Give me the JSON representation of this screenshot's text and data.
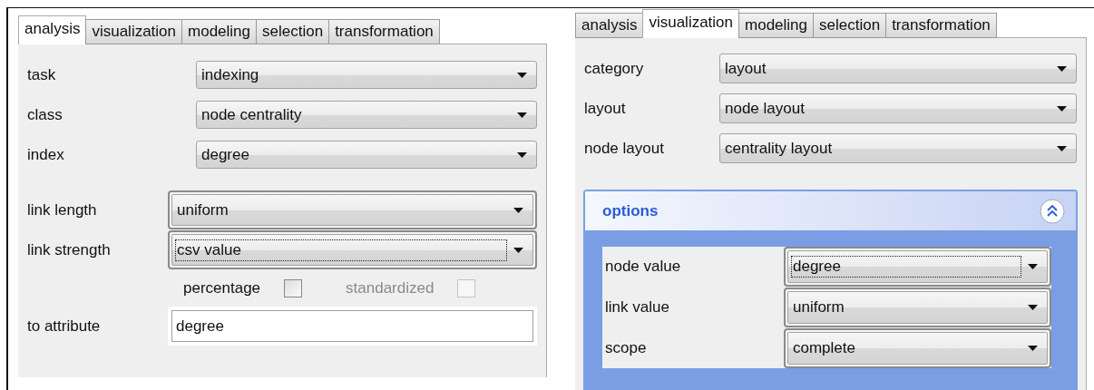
{
  "panels": [
    {
      "tabs": [
        {
          "label": "analysis",
          "selected": true
        },
        {
          "label": "visualization",
          "selected": false
        },
        {
          "label": "modeling",
          "selected": false
        },
        {
          "label": "selection",
          "selected": false
        },
        {
          "label": "transformation",
          "selected": false
        }
      ],
      "rows": [
        {
          "kind": "dropdown",
          "label": "task",
          "value": "indexing",
          "focused": false
        },
        {
          "kind": "dropdown",
          "label": "class",
          "value": "node centrality",
          "focused": false
        },
        {
          "kind": "dropdown",
          "label": "index",
          "value": "degree",
          "focused": false
        },
        {
          "kind": "framed",
          "label": "link length",
          "value": "uniform",
          "focused": false
        },
        {
          "kind": "framed",
          "label": "link strength",
          "value": "csv value",
          "focused": true
        },
        {
          "kind": "checkboxes",
          "items": [
            {
              "label": "percentage",
              "checked": false,
              "disabled": false
            },
            {
              "label": "standardized",
              "checked": false,
              "disabled": true
            }
          ]
        },
        {
          "kind": "text",
          "label": "to attribute",
          "value": "degree"
        }
      ]
    },
    {
      "tabs": [
        {
          "label": "analysis",
          "selected": false
        },
        {
          "label": "visualization",
          "selected": true
        },
        {
          "label": "modeling",
          "selected": false
        },
        {
          "label": "selection",
          "selected": false
        },
        {
          "label": "transformation",
          "selected": false
        }
      ],
      "rows": [
        {
          "kind": "dropdown",
          "label": "category",
          "value": "layout",
          "focused": false
        },
        {
          "kind": "dropdown",
          "label": "layout",
          "value": "node layout",
          "focused": false
        },
        {
          "kind": "dropdown",
          "label": "node layout",
          "value": "centrality layout",
          "focused": false
        }
      ],
      "options": {
        "title": "options",
        "expanded": true,
        "rows": [
          {
            "kind": "framed",
            "label": "node value",
            "value": "degree",
            "focused": true
          },
          {
            "kind": "framed",
            "label": "link value",
            "value": "uniform",
            "focused": false
          },
          {
            "kind": "framed",
            "label": "scope",
            "value": "complete",
            "focused": false
          }
        ]
      }
    }
  ]
}
